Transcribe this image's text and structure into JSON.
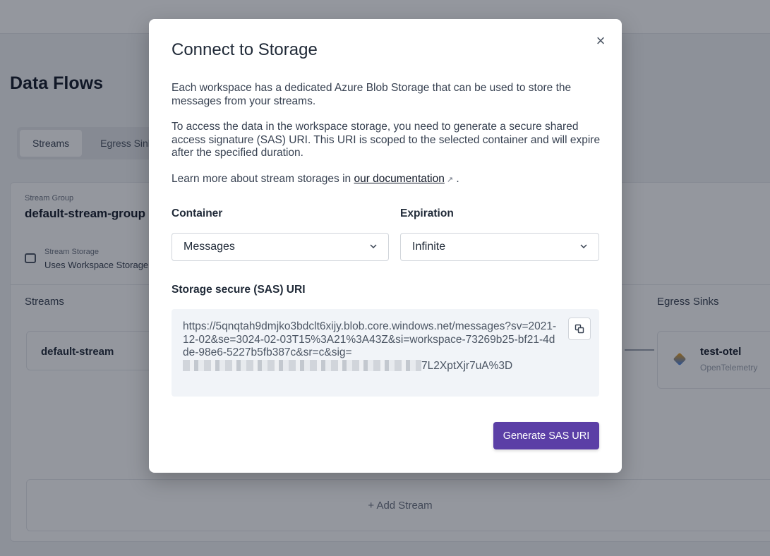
{
  "background": {
    "page_title": "Data Flows",
    "tabs": [
      {
        "label": "Streams"
      },
      {
        "label": "Egress Sinks"
      }
    ],
    "stream_group": {
      "label": "Stream Group",
      "name": "default-stream-group"
    },
    "stream_storage": {
      "label": "Stream Storage",
      "value": "Uses Workspace Storage"
    },
    "streams_heading": "Streams",
    "egress_heading": "Egress Sinks",
    "stream_card": {
      "name": "default-stream"
    },
    "sink_card": {
      "name": "test-otel",
      "type": "OpenTelemetry"
    },
    "add_stream": "+ Add Stream"
  },
  "modal": {
    "title": "Connect to Storage",
    "close_icon": "×",
    "paragraph1": "Each workspace has a dedicated Azure Blob Storage that can be used to store the messages from your streams.",
    "paragraph2": "To access the data in the workspace storage, you need to generate a secure shared access signature (SAS) URI. This URI is scoped to the selected container and will expire after the specified duration.",
    "paragraph3_prefix": "Learn more about stream storages in ",
    "doc_link": "our documentation",
    "paragraph3_suffix": " .",
    "container": {
      "label": "Container",
      "selected": "Messages"
    },
    "expiration": {
      "label": "Expiration",
      "selected": "Infinite"
    },
    "sas_label": "Storage secure (SAS) URI",
    "sas_uri_visible": "https://5qnqtah9dmjko3bdclt6xijy.blob.core.windows.net/messages?sv=2021-12-02&se=3024-02-03T15%3A21%3A43Z&si=workspace-73269b25-bf21-4dde-98e6-5227b5fb387c&sr=c&sig=",
    "sas_uri_tail": "7L2XptXjr7uA%3D",
    "generate_button": "Generate SAS URI"
  },
  "icons": {
    "close": "close-icon",
    "chevron": "chevron-down-icon",
    "copy": "copy-icon",
    "external_link": "external-link-icon",
    "storage": "storage-icon"
  },
  "colors": {
    "primary_button": "#5b3fa6",
    "uri_background": "#f1f4f8"
  }
}
